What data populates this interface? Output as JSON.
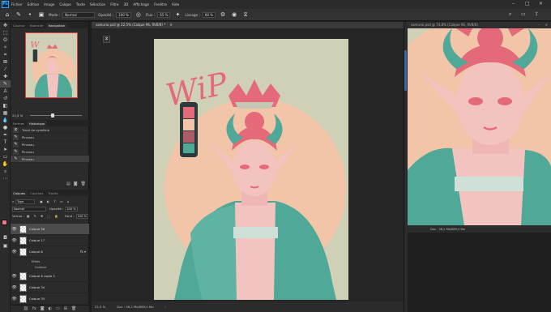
{
  "menubar": {
    "items": [
      "Fichier",
      "Edition",
      "Image",
      "Calque",
      "Texte",
      "Sélection",
      "Filtre",
      "3D",
      "Affichage",
      "Fenêtre",
      "Aide"
    ],
    "minimize": "–",
    "maximize": "□",
    "close": "✕"
  },
  "options": {
    "mode_label": "Mode :",
    "mode_value": "Normal",
    "opacity_label": "Opacité :",
    "opacity_value": "100 %",
    "flux_label": "Flux :",
    "flux_value": "65 %",
    "lissage_label": "Lissage :",
    "lissage_value": "60 %"
  },
  "navigator": {
    "tabs": [
      "Couleur",
      "Nuancier",
      "Navigation"
    ],
    "zoom": "22,5 %"
  },
  "history": {
    "tabs": [
      "Formes",
      "Historique"
    ],
    "items": [
      "Tracé de symétrie",
      "Pinceau",
      "Pinceau",
      "Pinceau",
      "Pinceau"
    ]
  },
  "layers": {
    "tabs": [
      "Calques",
      "Couches",
      "Tracés"
    ],
    "filter": "Type",
    "blend": "Normal",
    "opacity_label": "Opacité :",
    "opacity_value": "100 %",
    "lock_label": "Verrou :",
    "fill_label": "Fond :",
    "fill_value": "100 %",
    "items": [
      {
        "name": "Calque 96",
        "selected": true,
        "fx": false
      },
      {
        "name": "Calque 17",
        "selected": false,
        "fx": false
      },
      {
        "name": "Calque 8",
        "selected": false,
        "fx": true
      },
      {
        "name": "Calque 8 copie 2",
        "selected": false,
        "fx": false
      },
      {
        "name": "Calque 34",
        "selected": false,
        "fx": false
      },
      {
        "name": "Calque 33",
        "selected": false,
        "fx": false
      },
      {
        "name": "Calque 35",
        "selected": false,
        "fx": false
      },
      {
        "name": "Calque 32",
        "selected": false,
        "fx": false
      }
    ],
    "effects_label": "Effets",
    "contour_label": "Contour"
  },
  "document1": {
    "tab": "samurai.psd @ 22,5% (Calque 96, RVB/8) *",
    "status_zoom": "22,5 %",
    "status_doc": "Doc : 36,2 Mo/689,0 Mo"
  },
  "document2": {
    "tab": "samurai.psd @ 74,8% (Calque 96, RVB/8)",
    "status_doc": "Doc : 36,2 Mo/689,0 Mo"
  },
  "artwork": {
    "wip_text": "WiP"
  },
  "colors": {
    "canvas_bg": "#cfd0b5",
    "circle": "#f2c4a8",
    "pink": "#e46a7a",
    "teal": "#4fa898",
    "skin": "#f3c3c0",
    "foreground": "#e8798a",
    "background_swatch": "#ffffff"
  }
}
